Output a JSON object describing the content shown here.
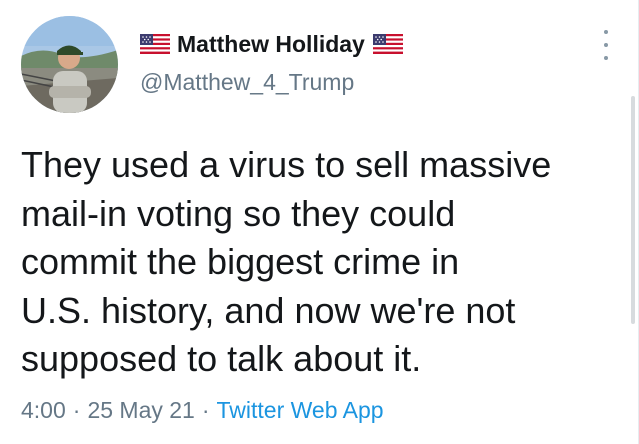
{
  "author": {
    "display_name": "Matthew Holliday",
    "handle": "@Matthew_4_Trump",
    "name_prefix_emoji": "us-flag-icon",
    "name_suffix_emoji": "us-flag-icon"
  },
  "tweet": {
    "lines": [
      "They used a virus to sell massive",
      "mail-in voting so they could",
      "commit the biggest crime in",
      "U.S. history, and now we're not",
      "supposed to talk about it."
    ]
  },
  "meta": {
    "time": "4:00",
    "separator": "·",
    "date": "25 May 21",
    "source": "Twitter Web App"
  },
  "colors": {
    "text": "#14171a",
    "secondary": "#657786",
    "link": "#1b95e0"
  }
}
